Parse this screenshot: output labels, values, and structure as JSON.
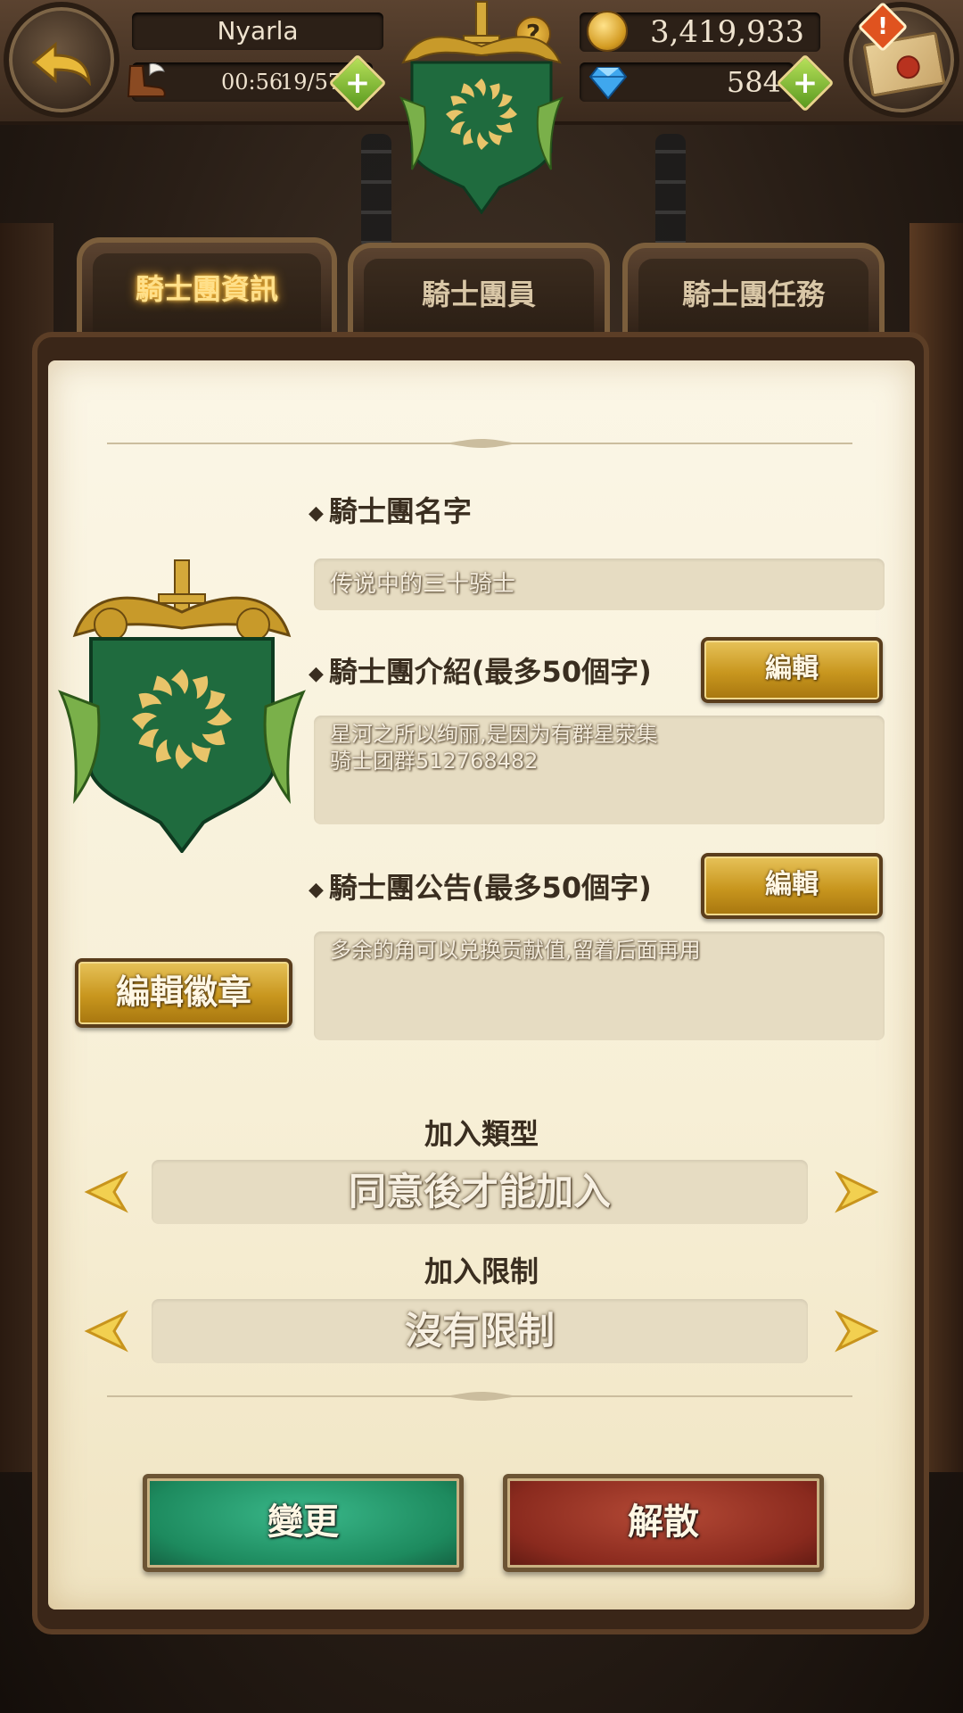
{
  "header": {
    "player_name": "Nyarla",
    "stamina_timer": "00:56",
    "stamina_count": "19/57",
    "gold": "3,419,933",
    "gems": "584",
    "help_symbol": "?",
    "alert_symbol": "!"
  },
  "tabs": [
    {
      "label": "騎士團資訊",
      "active": true
    },
    {
      "label": "騎士團員",
      "active": false
    },
    {
      "label": "騎士團任務",
      "active": false
    }
  ],
  "guild": {
    "name_label": "騎士團名字",
    "name_value": "传说中的三十骑士",
    "intro_label": "騎士團介紹(最多50個字)",
    "intro_value": "星河之所以绚丽,是因为有群星荥集\n骑士团群512768482",
    "notice_label": "騎士團公告(最多50個字)",
    "notice_value": "多余的角可以兑换贡献值,留着后面再用",
    "edit_label": "編輯",
    "edit_badge_label": "編輯徽章"
  },
  "join": {
    "type_label": "加入類型",
    "type_value": "同意後才能加入",
    "limit_label": "加入限制",
    "limit_value": "沒有限制"
  },
  "actions": {
    "change_label": "變更",
    "disband_label": "解散"
  },
  "colors": {
    "emblem_green": "#1f6b3e",
    "gold": "#d9a521",
    "change_green": "#1d8a5e",
    "disband_red": "#8a2a1e"
  }
}
